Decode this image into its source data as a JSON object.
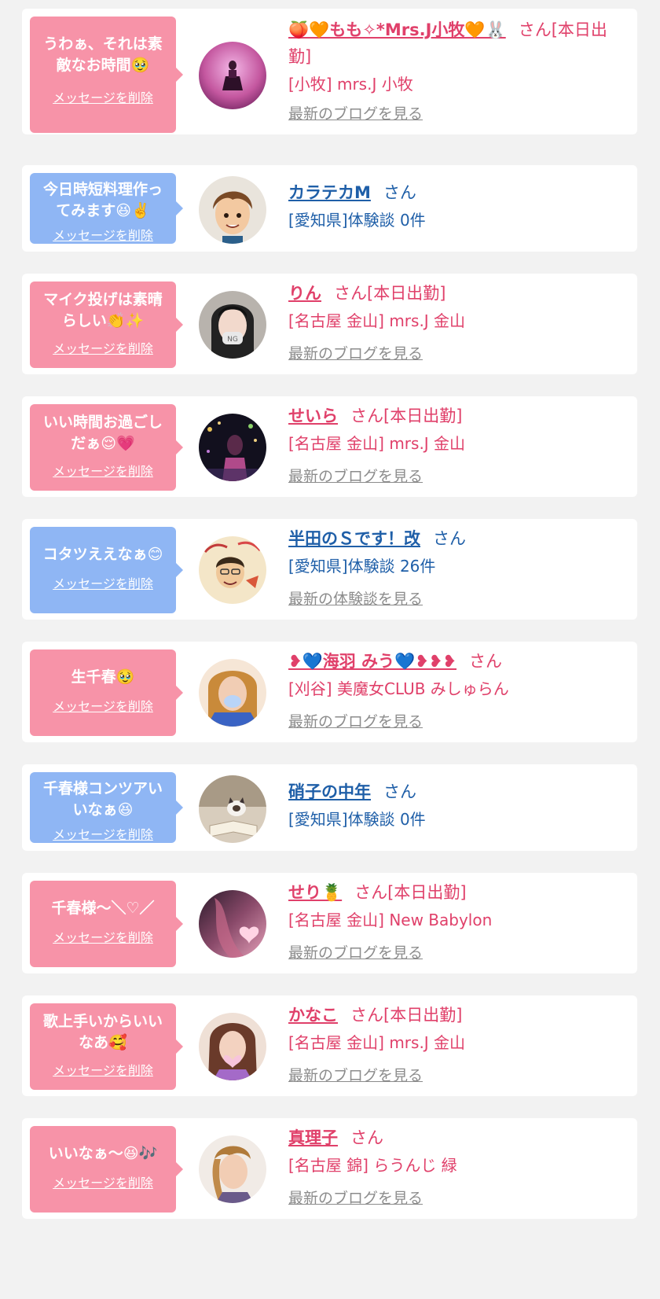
{
  "delete_label": "メッセージを削除",
  "san": "さん",
  "colors": {
    "pink_bubble": "#f793a8",
    "blue_bubble": "#8fb6f4",
    "pink_text": "#e0406a",
    "blue_text": "#1f5fa8",
    "link_gray": "#8c8c8c",
    "background": "#f2f2f2"
  },
  "items": [
    {
      "message": "うわぁ、それは素敵なお時間🥹",
      "name": "🍑🧡もも✧*Mrs.J小牧🧡🐰",
      "status": "[本日出勤]",
      "shop": "[小牧] mrs.J 小牧",
      "link": "最新のブログを見る",
      "avatar_icon": "performer-photo"
    },
    {
      "message": "今日時短料理作ってみます😆✌️",
      "name": "カラテカM",
      "status": "",
      "shop": "[愛知県]体験談 0件",
      "link": "",
      "avatar_icon": "anime-boy-avatar"
    },
    {
      "message": "マイク投げは素晴らしい👏✨",
      "name": "りん",
      "status": "[本日出勤]",
      "shop": "[名古屋 金山] mrs.J 金山",
      "link": "最新のブログを見る",
      "avatar_icon": "girl-photo"
    },
    {
      "message": "いい時間お過ごしだぁ😌💗",
      "name": "せいら",
      "status": "[本日出勤]",
      "shop": "[名古屋 金山] mrs.J 金山",
      "link": "最新のブログを見る",
      "avatar_icon": "night-lights-photo"
    },
    {
      "message": "コタツええなぁ😊",
      "name": "半田のＳです！改",
      "status": "",
      "shop": "[愛知県]体験談 26件",
      "link": "最新の体験談を見る",
      "avatar_icon": "caricature-avatar"
    },
    {
      "message": "生千春🥹",
      "name": "❥💙海羽 みう💙❥❥❥",
      "status": "",
      "shop": "[刈谷] 美魔女CLUB みしゅらん",
      "link": "最新のブログを見る",
      "avatar_icon": "woman-photo"
    },
    {
      "message": "千春様コンツアいいなぁ😆",
      "name": "硝子の中年",
      "status": "",
      "shop": "[愛知県]体験談 0件",
      "link": "",
      "avatar_icon": "cat-book-photo"
    },
    {
      "message": "千春様～＼♡／",
      "name": "せり🍍",
      "status": "[本日出勤]",
      "shop": "[名古屋 金山] New Babylon",
      "link": "最新のブログを見る",
      "avatar_icon": "blurred-hair-photo"
    },
    {
      "message": "歌上手いからいいなあ🥰",
      "name": "かなこ",
      "status": "[本日出勤]",
      "shop": "[名古屋 金山] mrs.J 金山",
      "link": "最新のブログを見る",
      "avatar_icon": "woman-heart-photo"
    },
    {
      "message": "いいなぁ～😆🎶",
      "name": "真理子",
      "status": "",
      "shop": "[名古屋 錦] らうんじ 緑",
      "link": "最新のブログを見る",
      "avatar_icon": "woman-side-photo"
    }
  ]
}
